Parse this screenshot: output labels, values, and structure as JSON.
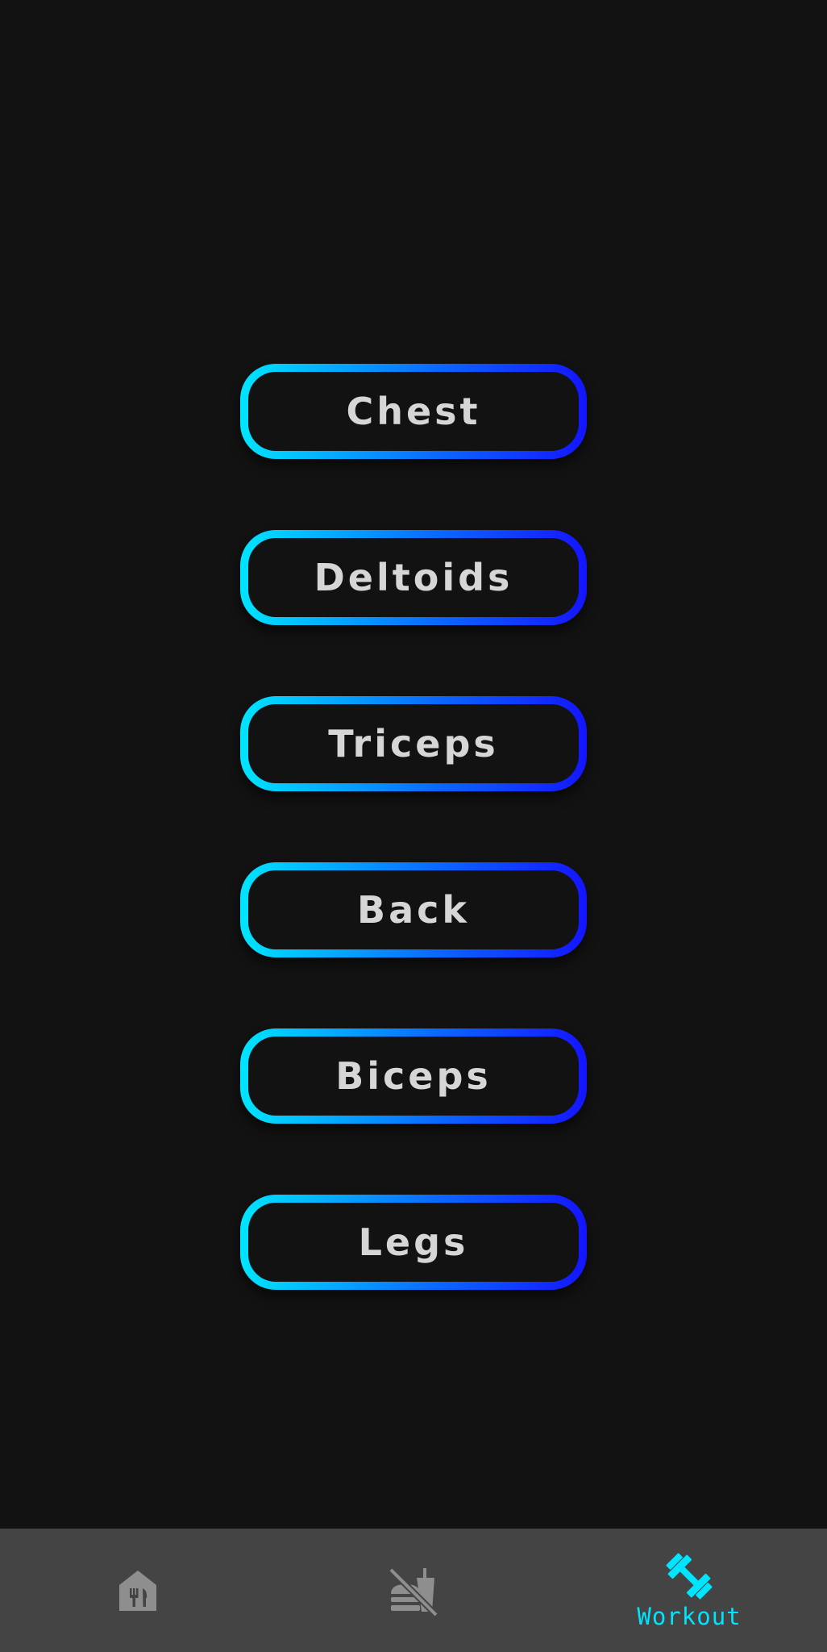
{
  "muscle_groups": [
    {
      "label": "Chest"
    },
    {
      "label": "Deltoids"
    },
    {
      "label": "Triceps"
    },
    {
      "label": "Back"
    },
    {
      "label": "Biceps"
    },
    {
      "label": "Legs"
    }
  ],
  "colors": {
    "background": "#121212",
    "button_gradient_start": "#00e5ff",
    "button_gradient_end": "#1414ff",
    "button_text": "#d6d6d6",
    "nav_background": "#444444",
    "nav_inactive_icon": "#8e8e8e",
    "nav_active": "#00e5ff"
  },
  "bottom_nav": {
    "items": [
      {
        "icon": "restaurant-house-icon",
        "label": "",
        "active": false
      },
      {
        "icon": "no-food-icon",
        "label": "",
        "active": false
      },
      {
        "icon": "dumbbell-icon",
        "label": "Workout",
        "active": true
      }
    ]
  }
}
